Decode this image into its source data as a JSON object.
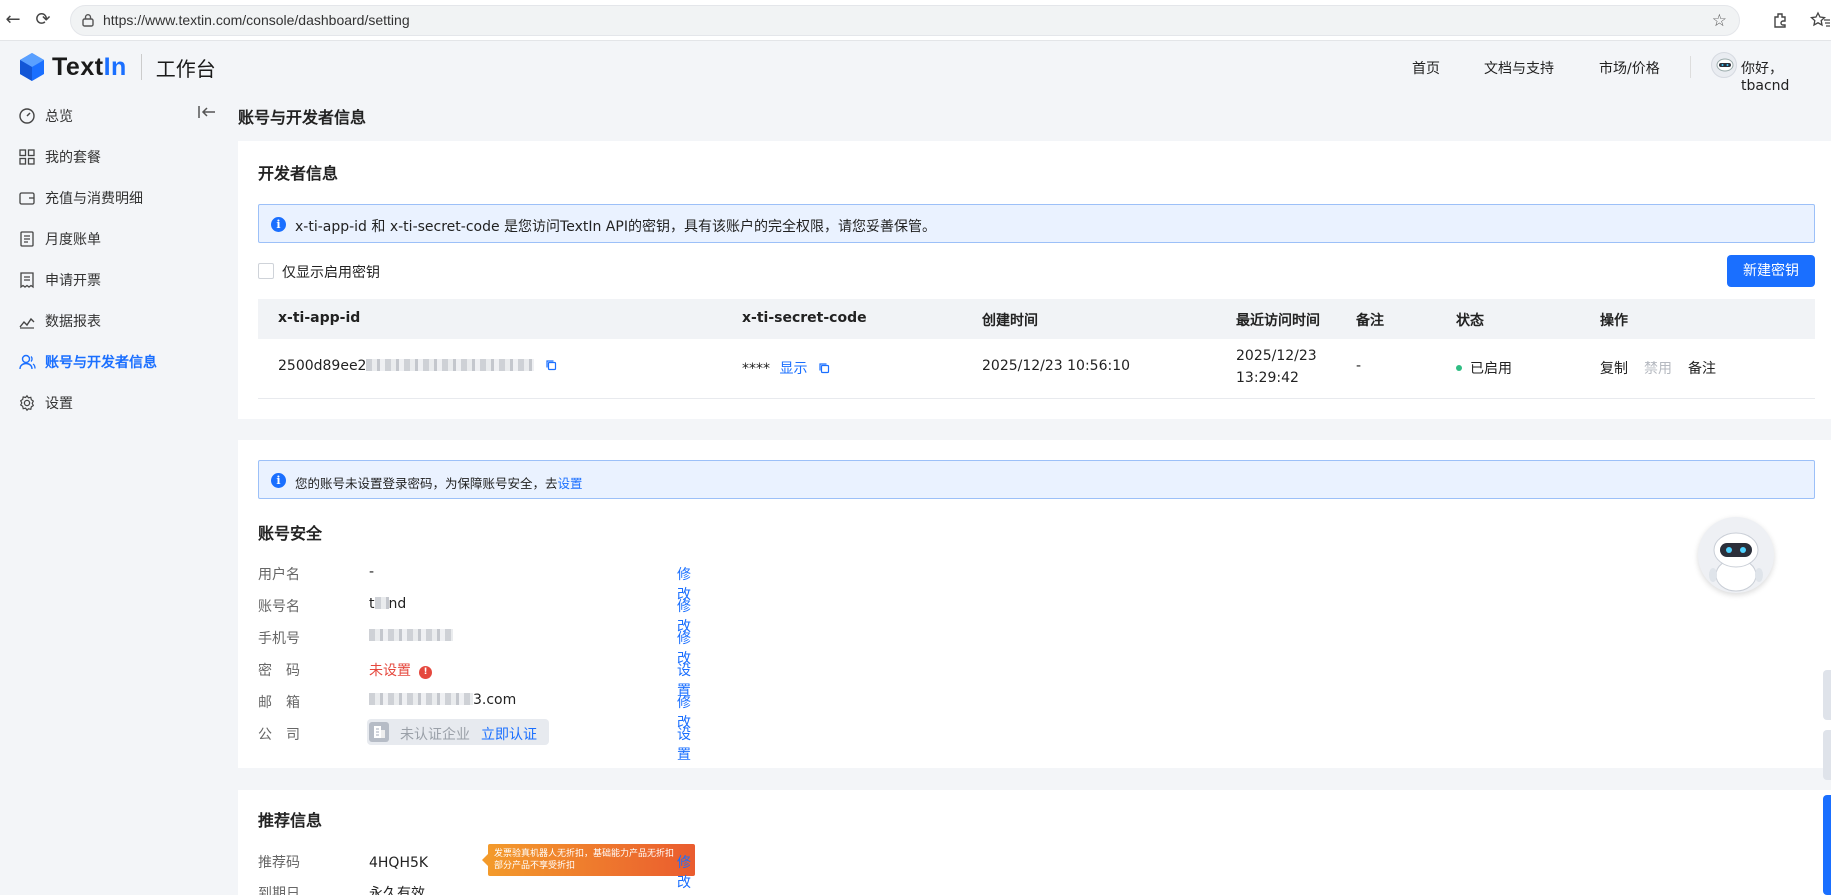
{
  "browser": {
    "url": "https://www.textin.com/console/dashboard/setting"
  },
  "header": {
    "brand": "TextIn",
    "workspace": "工作台",
    "nav": [
      "首页",
      "文档与支持",
      "市场/价格"
    ],
    "greeting": "你好，tbacnd"
  },
  "sidebar": {
    "items": [
      {
        "label": "总览",
        "icon": "dashboard-icon"
      },
      {
        "label": "我的套餐",
        "icon": "grid-icon"
      },
      {
        "label": "充值与消费明细",
        "icon": "wallet-icon"
      },
      {
        "label": "月度账单",
        "icon": "bill-icon"
      },
      {
        "label": "申请开票",
        "icon": "invoice-icon"
      },
      {
        "label": "数据报表",
        "icon": "chart-icon"
      },
      {
        "label": "账号与开发者信息",
        "icon": "user-icon",
        "active": true
      },
      {
        "label": "设置",
        "icon": "gear-icon"
      }
    ]
  },
  "page": {
    "title": "账号与开发者信息"
  },
  "developer": {
    "title": "开发者信息",
    "notice": "x-ti-app-id 和 x-ti-secret-code 是您访问TextIn API的密钥，具有该账户的完全权限，请您妥善保管。",
    "filter_label": "仅显示启用密钥",
    "new_button": "新建密钥",
    "columns": [
      "x-ti-app-id",
      "x-ti-secret-code",
      "创建时间",
      "最近访问时间",
      "备注",
      "状态",
      "操作"
    ],
    "row": {
      "app_id_prefix": "2500d89ee2",
      "secret_mask": "****",
      "show_label": "显示",
      "created": "2025/12/23 10:56:10",
      "last_access_date": "2025/12/23",
      "last_access_time": "13:29:42",
      "note": "-",
      "status": "已启用",
      "actions": [
        "复制",
        "禁用",
        "备注"
      ]
    }
  },
  "security": {
    "notice_text": "您的账号未设置登录密码，为保障账号安全，去",
    "notice_link": "设置",
    "title": "账号安全",
    "fields": [
      {
        "label": "用户名",
        "value": "-",
        "action": "修改"
      },
      {
        "label": "账号名",
        "value_prefix": "t",
        "value_suffix": "nd",
        "action": "修改"
      },
      {
        "label": "手机号",
        "value": "",
        "action": "修改"
      },
      {
        "label": "密　码",
        "value": "未设置",
        "action": "设置"
      },
      {
        "label": "邮　箱",
        "value_suffix": "3.com",
        "action": "修改"
      },
      {
        "label": "公　司",
        "company_status": "未认证企业",
        "company_link": "立即认证",
        "action": "设置"
      }
    ]
  },
  "referral": {
    "title": "推荐信息",
    "code_label": "推荐码",
    "code": "4HQH5K",
    "promo_line1": "发票验真机器人无折扣，基础能力产品无折扣",
    "promo_line2": "部分产品不享受折扣",
    "action": "修改",
    "expiry_label": "到期日",
    "expiry_value": "永久有效"
  },
  "colors": {
    "accent": "#1a6fff",
    "success": "#2fbd83",
    "danger": "#e5483e",
    "info_bg": "#eaf2ff"
  }
}
